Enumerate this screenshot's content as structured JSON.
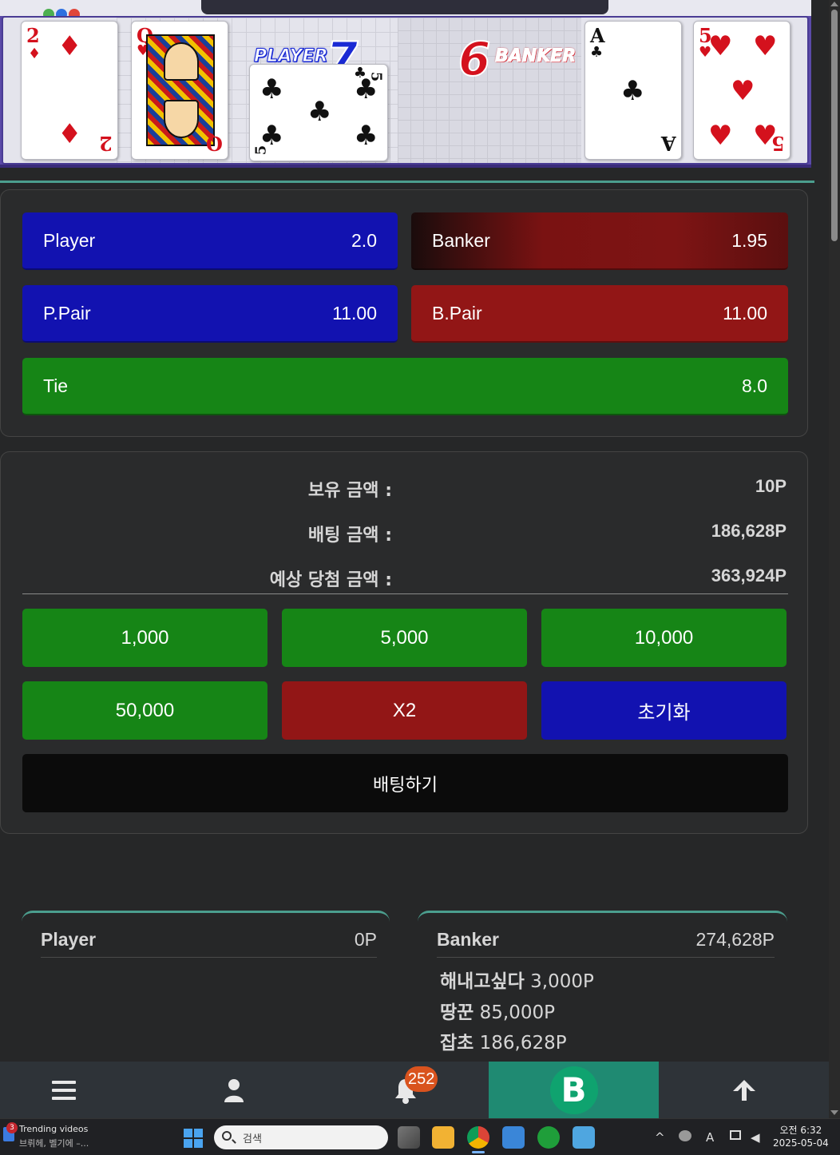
{
  "board": {
    "player_label": "PLAYER",
    "player_score": "7",
    "banker_label": "BANKER",
    "banker_score": "6",
    "player_cards": [
      {
        "rank": "2",
        "suit": "♦",
        "color": "#d4111d"
      },
      {
        "rank": "Q",
        "suit": "♥",
        "color": "#d4111d"
      },
      {
        "rank": "5",
        "suit": "♣",
        "color": "#111111"
      }
    ],
    "banker_cards": [
      {
        "rank": "A",
        "suit": "♣",
        "color": "#111111"
      },
      {
        "rank": "5",
        "suit": "♥",
        "color": "#d4111d"
      }
    ]
  },
  "bets": {
    "player": {
      "label": "Player",
      "odds": "2.0"
    },
    "banker": {
      "label": "Banker",
      "odds": "1.95"
    },
    "ppair": {
      "label": "P.Pair",
      "odds": "11.00"
    },
    "bpair": {
      "label": "B.Pair",
      "odds": "11.00"
    },
    "tie": {
      "label": "Tie",
      "odds": "8.0"
    }
  },
  "balance": {
    "held_label": "보유 금액 :",
    "held_value": "10P",
    "bet_label": "배팅 금액 :",
    "bet_value": "186,628P",
    "expected_label": "예상 당첨 금액 :",
    "expected_value": "363,924P"
  },
  "chips": {
    "c1000": "1,000",
    "c5000": "5,000",
    "c10000": "10,000",
    "c50000": "50,000",
    "x2": "X2",
    "reset": "초기화",
    "submit": "배팅하기"
  },
  "lists": {
    "player": {
      "title": "Player",
      "total": "0P",
      "entries": []
    },
    "banker": {
      "title": "Banker",
      "total": "274,628P",
      "entries": [
        {
          "name": "해내고싶다",
          "amount": "3,000P"
        },
        {
          "name": "땅꾼",
          "amount": "85,000P"
        },
        {
          "name": "잡초",
          "amount": "186,628P"
        }
      ]
    }
  },
  "nav": {
    "notification_count": "252",
    "b_label": "B"
  },
  "taskbar": {
    "trending_title": "Trending videos",
    "trending_sub": "브뤼헤, 벨기에 –...",
    "trending_badge": "3",
    "search_placeholder": "검색",
    "ime": "A",
    "time": "오전 6:32",
    "date": "2025-05-04"
  },
  "colors": {
    "player_blue": "#1212b0",
    "banker_red": "#921616",
    "tie_green": "#168516",
    "teal_accent": "#1f8a72",
    "badge_orange": "#d9531e"
  }
}
